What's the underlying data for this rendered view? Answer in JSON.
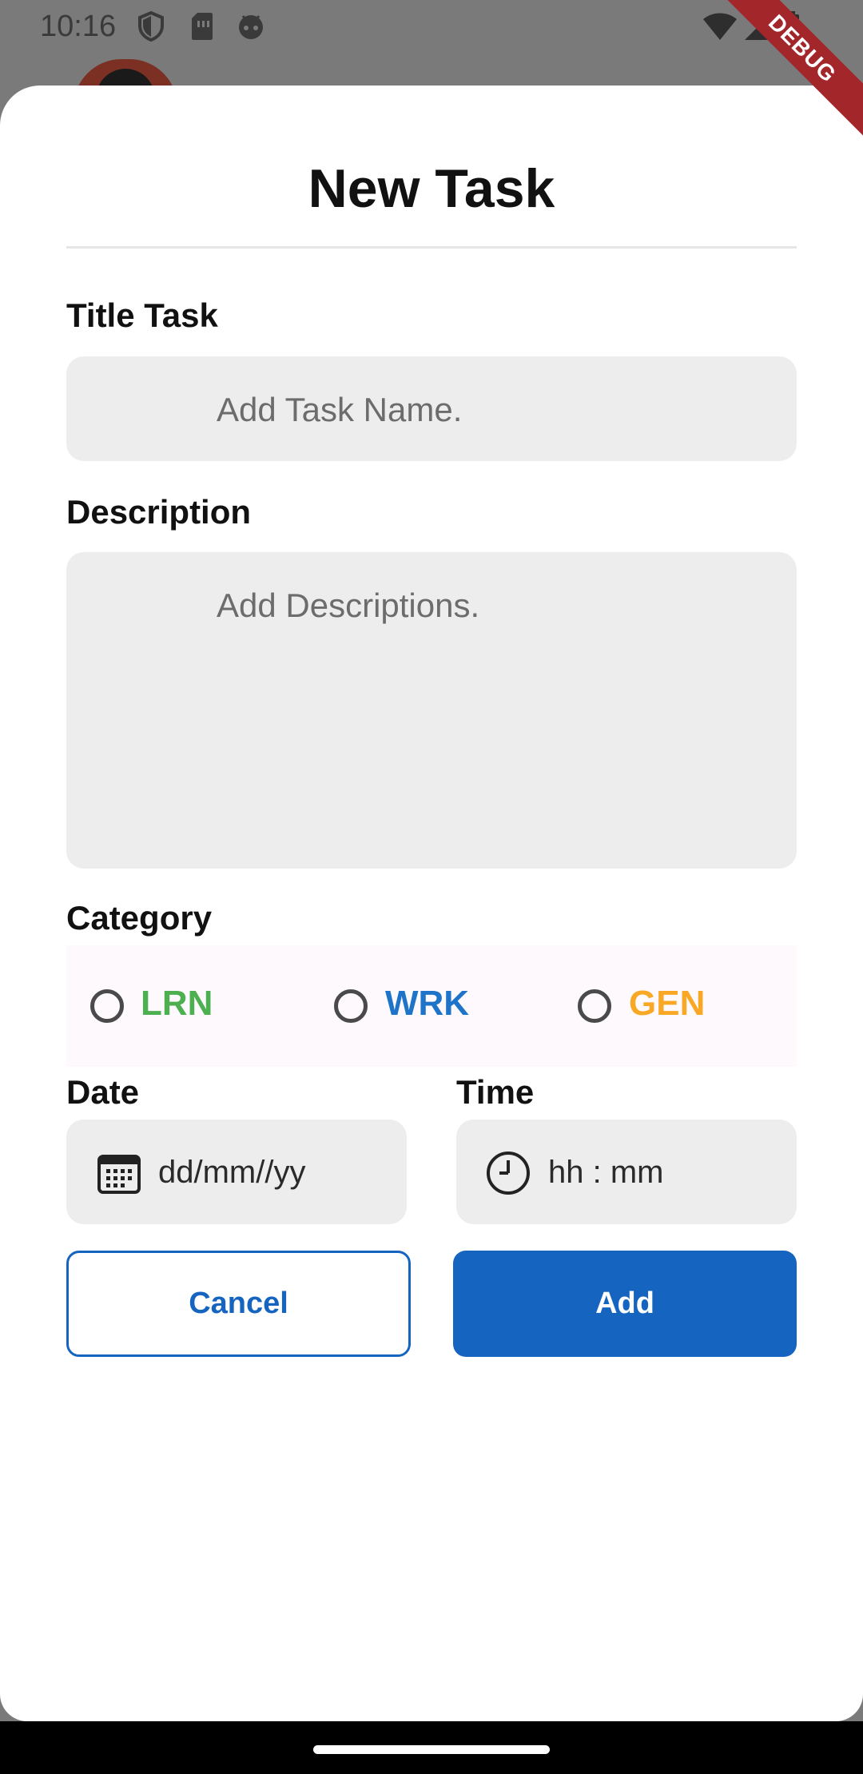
{
  "status_bar": {
    "time": "10:16",
    "left_icons": [
      "shield-icon",
      "sim-card-icon",
      "android-face-icon"
    ],
    "right_icons": [
      "wifi-icon",
      "signal-icon",
      "battery-icon"
    ]
  },
  "debug_banner": "DEBUG",
  "sheet": {
    "title": "New Task",
    "title_task": {
      "label": "Title Task",
      "placeholder": "Add Task Name."
    },
    "description": {
      "label": "Description",
      "placeholder": "Add Descriptions."
    },
    "category": {
      "label": "Category",
      "options": [
        {
          "label": "LRN",
          "color": "#4caf50"
        },
        {
          "label": "WRK",
          "color": "#1e74c9"
        },
        {
          "label": "GEN",
          "color": "#f9a825"
        }
      ]
    },
    "date": {
      "label": "Date",
      "placeholder": "dd/mm//yy",
      "icon": "calendar-icon"
    },
    "time": {
      "label": "Time",
      "placeholder": "hh : mm",
      "icon": "clock-icon"
    },
    "buttons": {
      "cancel": "Cancel",
      "add": "Add"
    }
  },
  "colors": {
    "primary": "#1565c0",
    "field_background": "#ededed",
    "scrim": "#7a7a7a"
  }
}
